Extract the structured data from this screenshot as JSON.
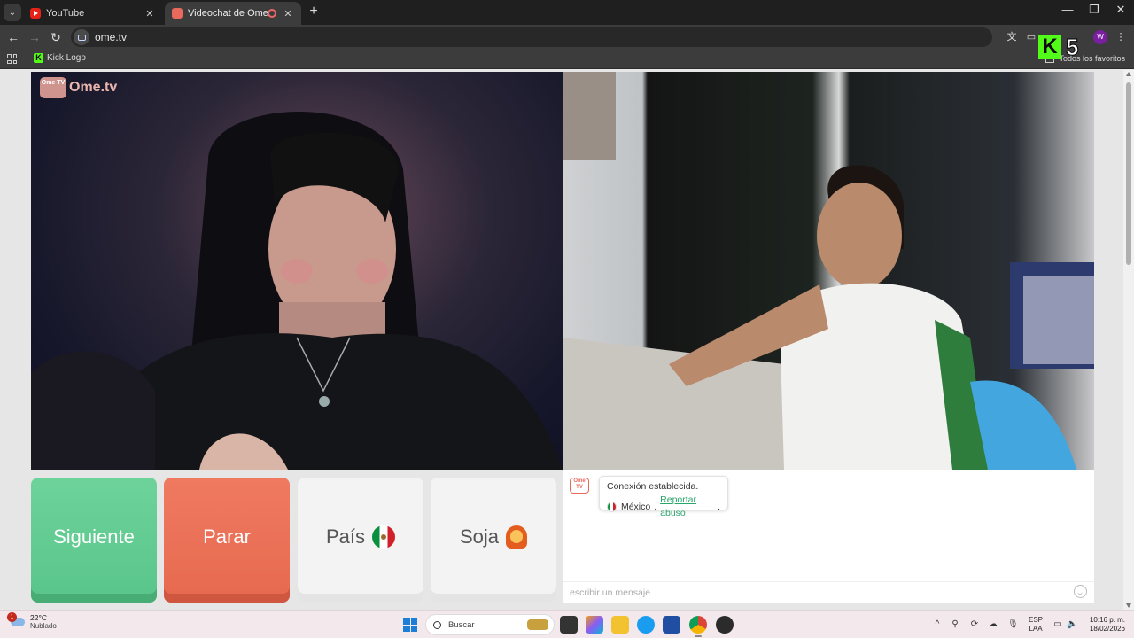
{
  "browser": {
    "tabs": [
      {
        "title": "YouTube",
        "active": false
      },
      {
        "title": "Videochat de OmeTV: una ...",
        "active": true
      }
    ],
    "url": "ome.tv",
    "bookmarks": [
      {
        "label": "Kick Logo"
      }
    ],
    "all_bookmarks_label": "Todos los favoritos",
    "profile_initial": "W",
    "overlay": {
      "letter": "K",
      "number": "5"
    }
  },
  "page": {
    "logo": {
      "icon_text": "Ome TV",
      "text": "Ome.tv"
    },
    "buttons": {
      "next": "Siguiente",
      "stop": "Parar",
      "country": "País",
      "gender": "Soja"
    },
    "chat": {
      "icon_text": "Ome TV",
      "status": "Conexión establecida.",
      "country": "México",
      "separator": ".",
      "report": "Reportar abuso",
      "report_suffix": ".",
      "input_placeholder": "escribir un mensaje"
    }
  },
  "taskbar": {
    "weather": {
      "temp": "22°C",
      "condition": "Nublado",
      "badge": "1"
    },
    "search_placeholder": "Buscar",
    "lang": {
      "line1": "ESP",
      "line2": "LAA"
    },
    "clock": {
      "time": "10:16 p. m.",
      "date": "18/02/2026"
    }
  },
  "colors": {
    "next": "#5dc98d",
    "stop": "#e96d52",
    "report_link": "#2aa56b",
    "kick": "#53fc18"
  }
}
